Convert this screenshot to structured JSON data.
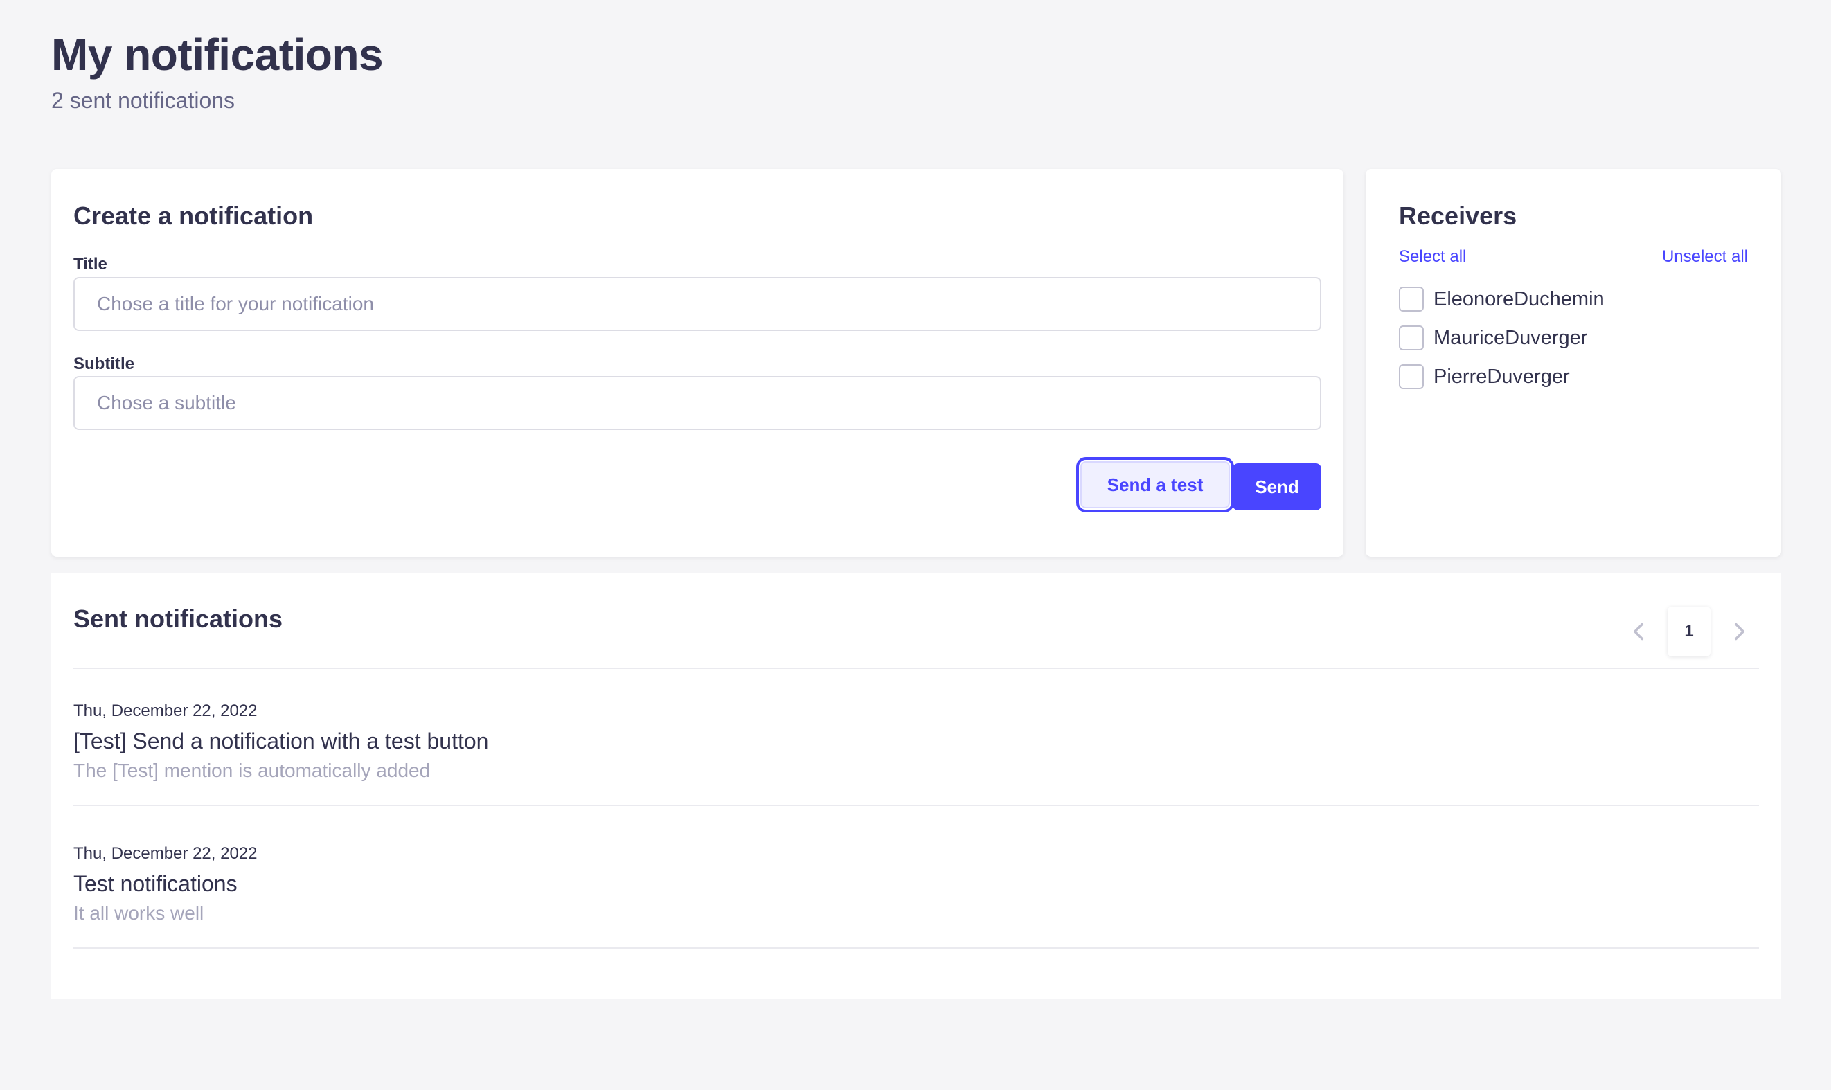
{
  "header": {
    "title": "My notifications",
    "subtitle": "2 sent notifications"
  },
  "create": {
    "title": "Create a notification",
    "title_label": "Title",
    "title_placeholder": "Chose a title for your notification",
    "subtitle_label": "Subtitle",
    "subtitle_placeholder": "Chose a subtitle",
    "send_test_label": "Send a test",
    "send_label": "Send"
  },
  "receivers": {
    "title": "Receivers",
    "select_all": "Select all",
    "unselect_all": "Unselect all",
    "items": [
      {
        "name": "EleonoreDuchemin",
        "checked": false
      },
      {
        "name": "MauriceDuverger",
        "checked": false
      },
      {
        "name": "PierreDuverger",
        "checked": false
      }
    ]
  },
  "sent": {
    "title": "Sent notifications",
    "pagination": {
      "current_page": "1"
    },
    "items": [
      {
        "date": "Thu, December 22, 2022",
        "title": "[Test] Send a notification with a test button",
        "subtitle": "The [Test] mention is automatically added"
      },
      {
        "date": "Thu, December 22, 2022",
        "title": "Test notifications",
        "subtitle": "It all works well"
      }
    ]
  },
  "colors": {
    "primary": "#4945ff",
    "background": "#f5f5f7",
    "text": "#32324d",
    "muted": "#a5a5ba"
  }
}
